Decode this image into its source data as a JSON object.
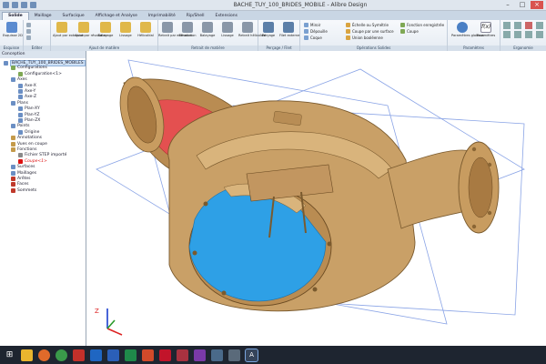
{
  "window": {
    "title": "BACHE_TUY_100_BRIDES_MOBILE - Alibre Design"
  },
  "ribbon": {
    "tabs": [
      "Solide",
      "Maillage",
      "Surfacique",
      "Affichage et Analyse",
      "Imprimabilité",
      "Rip/Shell",
      "Extensions"
    ],
    "active_tab": "Solide",
    "groups": [
      {
        "caption": "Esquisse",
        "buttons": [
          "Esquisse 2D"
        ]
      },
      {
        "caption": "Éditer",
        "buttons": []
      },
      {
        "caption": "Ajout de matière",
        "buttons": [
          "Ajout par extrusion",
          "Ajout par révolution",
          "Balayage",
          "Lissage",
          "Hélicoïdal"
        ]
      },
      {
        "caption": "Retrait de matière",
        "buttons": [
          "Retrait par extrusion",
          "Révolution",
          "Balayage",
          "Lissage",
          "Retrait hélicoïdal"
        ]
      },
      {
        "caption": "Perçage / Filet",
        "buttons": [
          "Perçage",
          "Filet externe"
        ]
      },
      {
        "caption": "Opérations Solides",
        "buttons": [
          "Miroir",
          "Échelle ou Symétrie",
          "Fonction enregistrée",
          "Dépouille",
          "Coupe par une surface",
          "Coque",
          "Union booléenne",
          "Coupe"
        ]
      },
      {
        "caption": "Paramètres",
        "buttons": [
          "Paramètres globaux",
          "Paramètres"
        ]
      },
      {
        "caption": "Ergonomie",
        "buttons": []
      }
    ]
  },
  "tree": {
    "header": "Conception",
    "items": [
      {
        "label": "BACHE_TUY_100_BRIDES_MOBILES",
        "level": 0,
        "selected": true,
        "color": "#6b8fc4"
      },
      {
        "label": "Configurations",
        "level": 1,
        "color": "#7fa855"
      },
      {
        "label": "Configuration<1>",
        "level": 2,
        "color": "#7fa855"
      },
      {
        "label": "Axes",
        "level": 1,
        "color": "#6b8fc4"
      },
      {
        "label": "Axe-X",
        "level": 2,
        "color": "#6b8fc4"
      },
      {
        "label": "Axe-Y",
        "level": 2,
        "color": "#6b8fc4"
      },
      {
        "label": "Axe-Z",
        "level": 2,
        "color": "#6b8fc4"
      },
      {
        "label": "Plans",
        "level": 1,
        "color": "#6b8fc4"
      },
      {
        "label": "Plan-XY",
        "level": 2,
        "color": "#6b8fc4"
      },
      {
        "label": "Plan-YZ",
        "level": 2,
        "color": "#6b8fc4"
      },
      {
        "label": "Plan-ZX",
        "level": 2,
        "color": "#6b8fc4"
      },
      {
        "label": "Points",
        "level": 1,
        "color": "#6b8fc4"
      },
      {
        "label": "Origine",
        "level": 2,
        "color": "#6b8fc4"
      },
      {
        "label": "Annotations",
        "level": 1,
        "color": "#c49a4a"
      },
      {
        "label": "Vues en coupe",
        "level": 1,
        "color": "#c49a4a"
      },
      {
        "label": "Fonctions",
        "level": 1,
        "color": "#c49a4a"
      },
      {
        "label": "Fichier STEP importé",
        "level": 2,
        "color": "#8a8a8a"
      },
      {
        "label": "Coupe<1>",
        "level": 2,
        "color": "#d11",
        "red": true
      },
      {
        "label": "Surfaces",
        "level": 1,
        "color": "#6b8fc4"
      },
      {
        "label": "Maillages",
        "level": 1,
        "color": "#6b8fc4"
      },
      {
        "label": "Arêtes",
        "level": 1,
        "color": "#c0392b"
      },
      {
        "label": "Faces",
        "level": 1,
        "color": "#c0392b"
      },
      {
        "label": "Sommets",
        "level": 1,
        "color": "#c0392b"
      }
    ]
  },
  "viewport": {
    "axis_labels": {
      "z": "Z",
      "x": "X",
      "y": "Y"
    },
    "part_color": "#c8a26a",
    "cut_red": "#e04848",
    "cut_blue": "#2ea0e6"
  },
  "taskbar": {
    "icons": [
      "windows-start",
      "file-explorer",
      "firefox",
      "chrome",
      "app-red",
      "outlook",
      "word",
      "excel",
      "powerpoint",
      "acrobat",
      "access",
      "onenote",
      "photo",
      "gear",
      "alibre"
    ]
  }
}
